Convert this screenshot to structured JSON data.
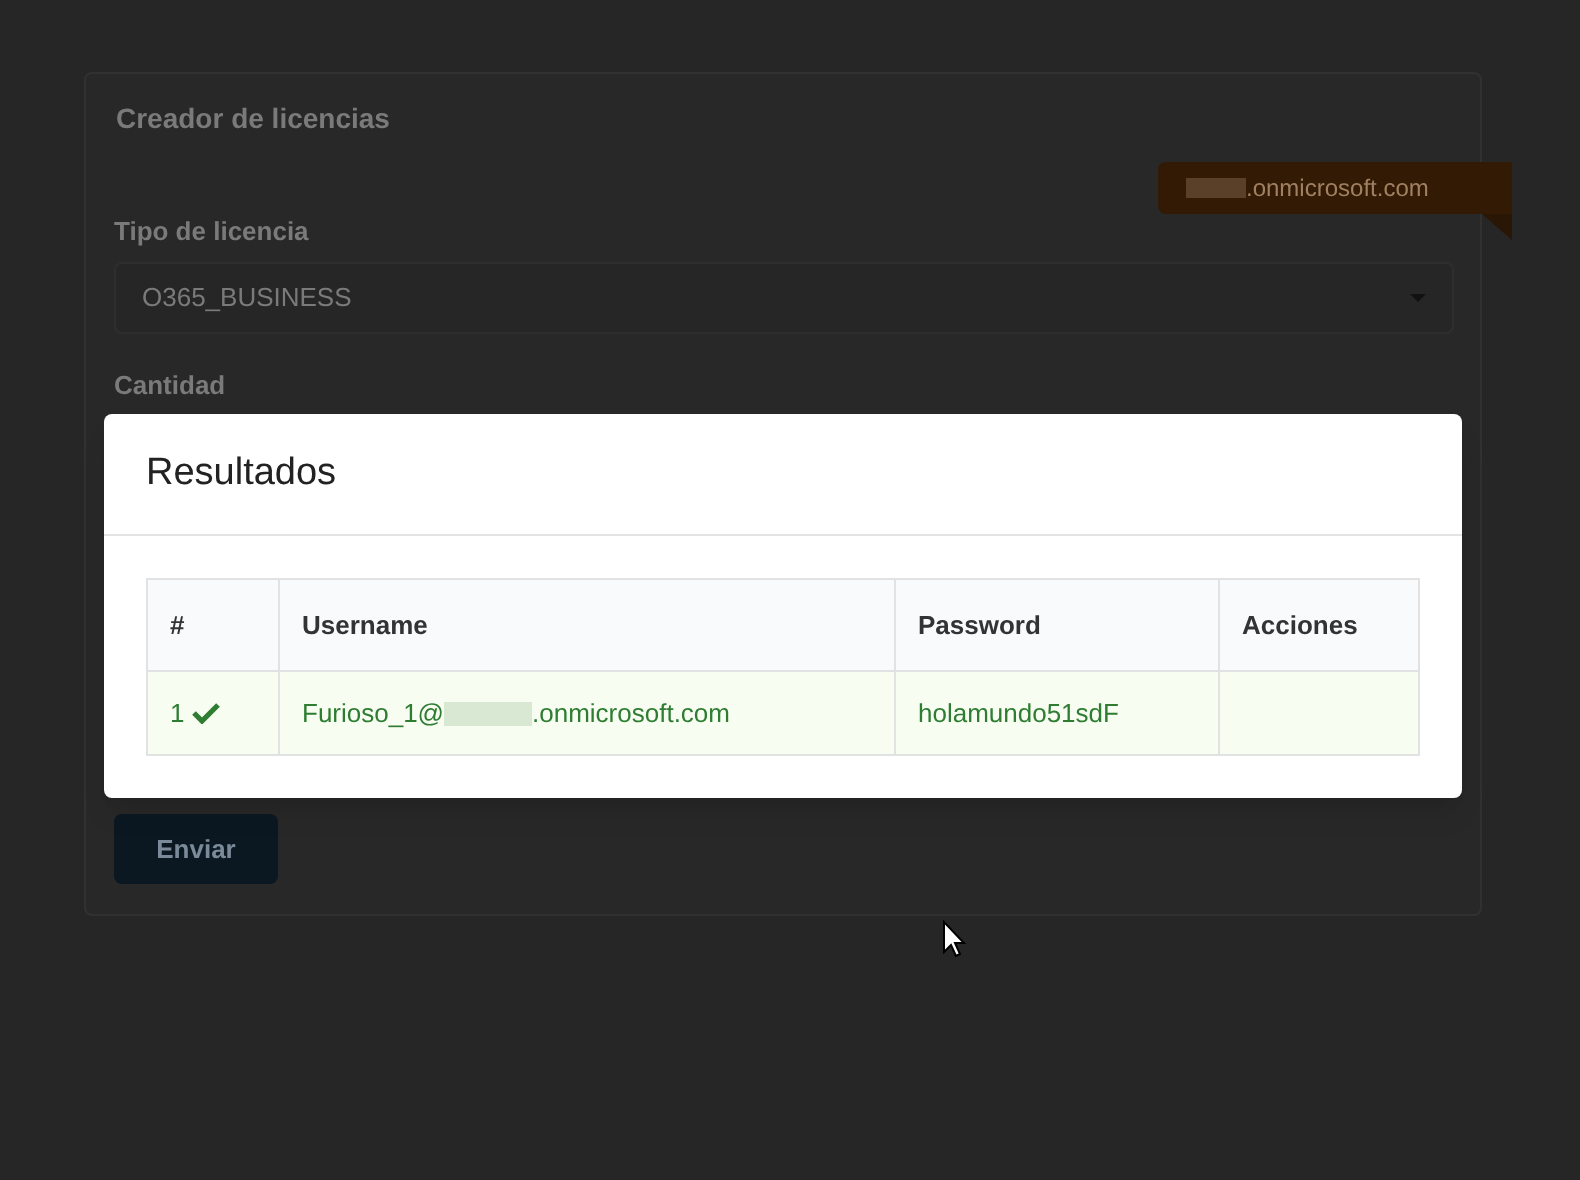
{
  "form": {
    "title": "Creador de licencias",
    "domain_badge": {
      "redacted": true,
      "text": ".onmicrosoft.com"
    },
    "fields": [
      {
        "label": "Tipo de licencia",
        "kind": "select",
        "value": "O365_BUSINESS"
      },
      {
        "label": "Cantidad",
        "kind": "hidden"
      }
    ],
    "submit": "Enviar"
  },
  "modal": {
    "title": "Resultados",
    "table": {
      "columns": [
        "#",
        "Username",
        "Password",
        "Acciones"
      ],
      "rows": [
        {
          "index": "1",
          "success": true,
          "username_prefix": "Furioso_1@",
          "username_redacted": true,
          "username_suffix": ".onmicrosoft.com",
          "password": "holamundo51sdF",
          "actions": ""
        }
      ]
    }
  }
}
